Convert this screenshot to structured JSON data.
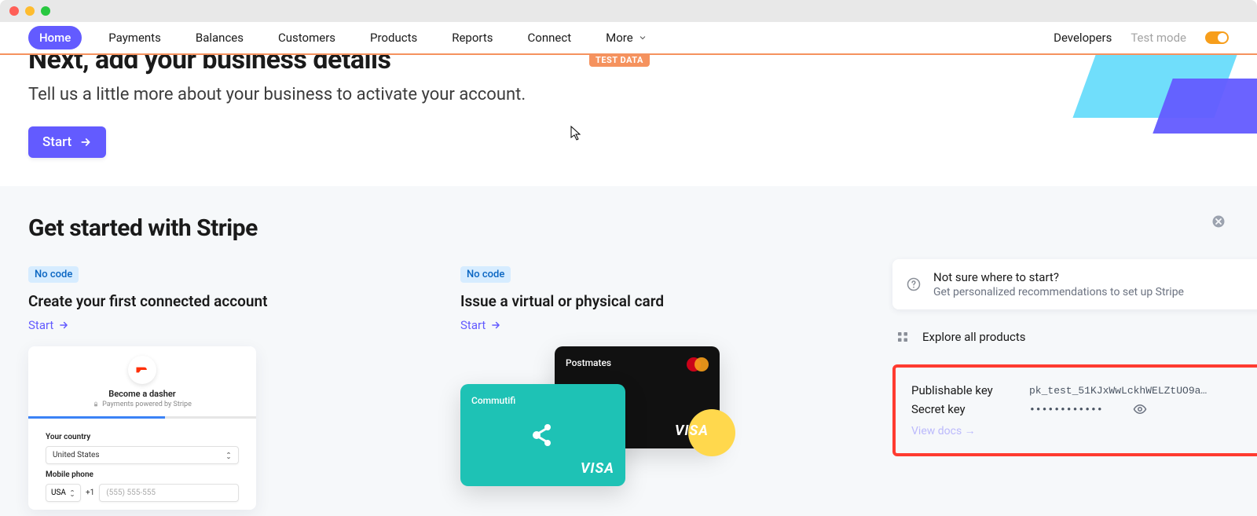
{
  "nav": {
    "items": [
      "Home",
      "Payments",
      "Balances",
      "Customers",
      "Products",
      "Reports",
      "Connect",
      "More"
    ],
    "developers": "Developers",
    "test_mode_label": "Test mode"
  },
  "test_data_badge": "TEST DATA",
  "hero": {
    "title": "Next, add your business details",
    "subtitle": "Tell us a little more about your business to activate your account.",
    "cta": "Start"
  },
  "get_started": {
    "heading": "Get started with Stripe",
    "col1": {
      "badge": "No code",
      "title": "Create your first connected account",
      "start": "Start",
      "dasher": {
        "title": "Become a dasher",
        "subtitle": "Payments powered by Stripe",
        "country_label": "Your country",
        "country_value": "United States",
        "mobile_label": "Mobile phone",
        "cc": "USA",
        "plus1": "+1",
        "placeholder": "(555) 555-555"
      }
    },
    "col2": {
      "badge": "No code",
      "title": "Issue a virtual or physical card",
      "start": "Start",
      "card_black_brand": "Postmates",
      "card_teal_brand": "Commutifi",
      "visa": "VISA"
    },
    "side": {
      "not_sure_title": "Not sure where to start?",
      "not_sure_sub": "Get personalized recommendations to set up Stripe",
      "explore": "Explore all products",
      "keys": {
        "pk_label": "Publishable key",
        "pk_value": "pk_test_51KJxWwLckhWELZtUO9a…",
        "sk_label": "Secret key",
        "sk_value": "••••••••••••",
        "docs": "View docs →"
      }
    }
  }
}
